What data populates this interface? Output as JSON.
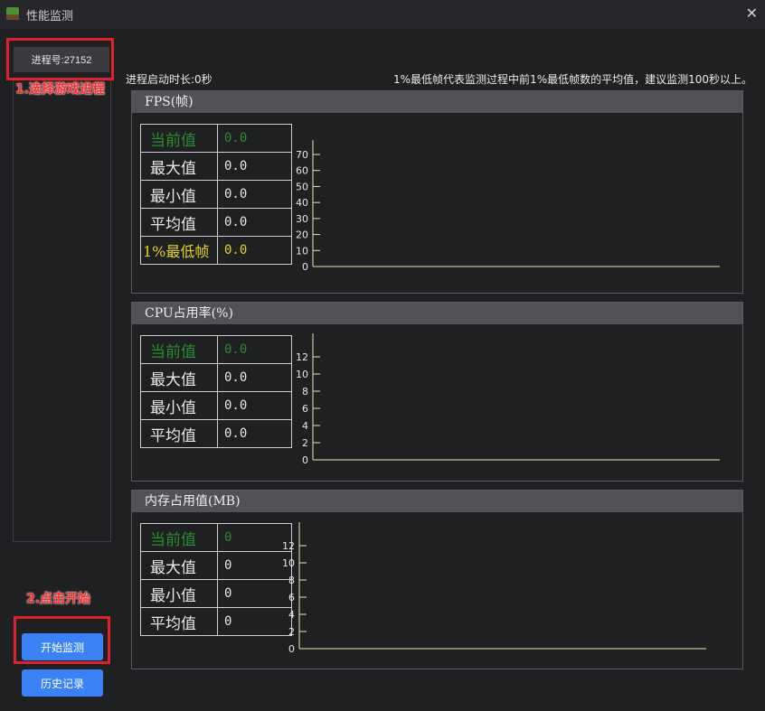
{
  "window": {
    "title": "性能监测",
    "close_glyph": "✕"
  },
  "sidebar": {
    "process_button": "进程号:27152",
    "step1_note": "1.选择游戏进程",
    "step2_note": "2.点击开始",
    "start_button": "开始监测",
    "history_button": "历史记录"
  },
  "status": {
    "runtime": "进程启动时长:0秒",
    "hint": "1%最低帧代表监测过程中前1%最低帧数的平均值，建议监测100秒以上。"
  },
  "fps": {
    "title": "FPS(帧)",
    "rows": [
      {
        "label": "当前值",
        "value": "0.0"
      },
      {
        "label": "最大值",
        "value": "0.0"
      },
      {
        "label": "最小值",
        "value": "0.0"
      },
      {
        "label": "平均值",
        "value": "0.0"
      },
      {
        "label": "1%最低帧",
        "value": "0.0"
      }
    ]
  },
  "cpu": {
    "title": "CPU占用率(%)",
    "rows": [
      {
        "label": "当前值",
        "value": "0.0"
      },
      {
        "label": "最大值",
        "value": "0.0"
      },
      {
        "label": "最小值",
        "value": "0.0"
      },
      {
        "label": "平均值",
        "value": "0.0"
      }
    ]
  },
  "mem": {
    "title": "内存占用值(MB)",
    "rows": [
      {
        "label": "当前值",
        "value": "0"
      },
      {
        "label": "最大值",
        "value": "0"
      },
      {
        "label": "最小值",
        "value": "0"
      },
      {
        "label": "平均值",
        "value": "0"
      }
    ]
  },
  "colors": {
    "current_value": "#2e8b2e",
    "low_fps": "#e6d21a",
    "axis": "#f2e3b0",
    "accent_button": "#3b82f6",
    "annotation_red": "#e0212a"
  },
  "chart_data": [
    {
      "type": "line",
      "name_ref": "fps",
      "y_ticks": [
        0,
        10,
        20,
        30,
        40,
        50,
        60,
        70
      ],
      "ylim": [
        0,
        70
      ],
      "series": []
    },
    {
      "type": "line",
      "name_ref": "cpu",
      "y_ticks": [
        0,
        2,
        4,
        6,
        8,
        10,
        12
      ],
      "ylim": [
        0,
        12
      ],
      "series": []
    },
    {
      "type": "line",
      "name_ref": "mem",
      "y_ticks": [
        0,
        2,
        4,
        6,
        8,
        10,
        12
      ],
      "ylim": [
        0,
        12
      ],
      "series": []
    }
  ]
}
